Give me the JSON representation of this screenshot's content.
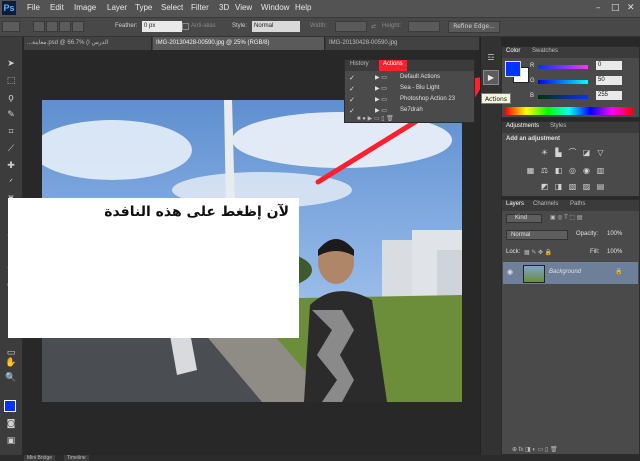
{
  "menu": {
    "logo": "Ps",
    "items": [
      "File",
      "Edit",
      "Image",
      "Layer",
      "Type",
      "Select",
      "Filter",
      "3D",
      "View",
      "Window",
      "Help"
    ],
    "window_controls": [
      "–",
      "□",
      "✕"
    ]
  },
  "options": {
    "feather_label": "Feather:",
    "feather_value": "0 px",
    "antialias_label": "Anti-alias",
    "style_label": "Style:",
    "style_value": "Normal",
    "width_label": "Width:",
    "height_label": "Height:",
    "refine_edge": "Refine Edge..."
  },
  "doc_tabs": [
    {
      "label": "...معاينة.psd @ 66.7% (الدرس ا"
    },
    {
      "label": "IMG-20130428-00590.jpg @ 25% (RGB/8)"
    },
    {
      "label": "IMG-20130428-00590.jpg"
    }
  ],
  "actions_panel": {
    "tabs": [
      "History",
      "Actions"
    ],
    "items": [
      "Default Actions",
      "Sea - Blu Light",
      "Photoshop Action 23",
      "Se7drah"
    ]
  },
  "tooltip": "Actions",
  "color_panel": {
    "tabs": [
      "Color",
      "Swatches"
    ],
    "channels": [
      {
        "label": "R",
        "value": "0"
      },
      {
        "label": "G",
        "value": "50"
      },
      {
        "label": "B",
        "value": "255"
      }
    ],
    "foreground": "#0033ff",
    "background": "#ffffff"
  },
  "adjustments_panel": {
    "tabs": [
      "Adjustments",
      "Styles"
    ],
    "heading": "Add an adjustment"
  },
  "layers_panel": {
    "tabs": [
      "Layers",
      "Channels",
      "Paths"
    ],
    "kind_label": "Kind",
    "blend_mode": "Normal",
    "opacity_label": "Opacity:",
    "opacity_value": "100%",
    "lock_label": "Lock:",
    "fill_label": "Fill:",
    "fill_value": "100%",
    "layer_name": "Background"
  },
  "callout": {
    "text": "لآن إظغط على هذه النافدة"
  },
  "bottom_tabs": [
    "Mini Bridge",
    "Timeline"
  ]
}
